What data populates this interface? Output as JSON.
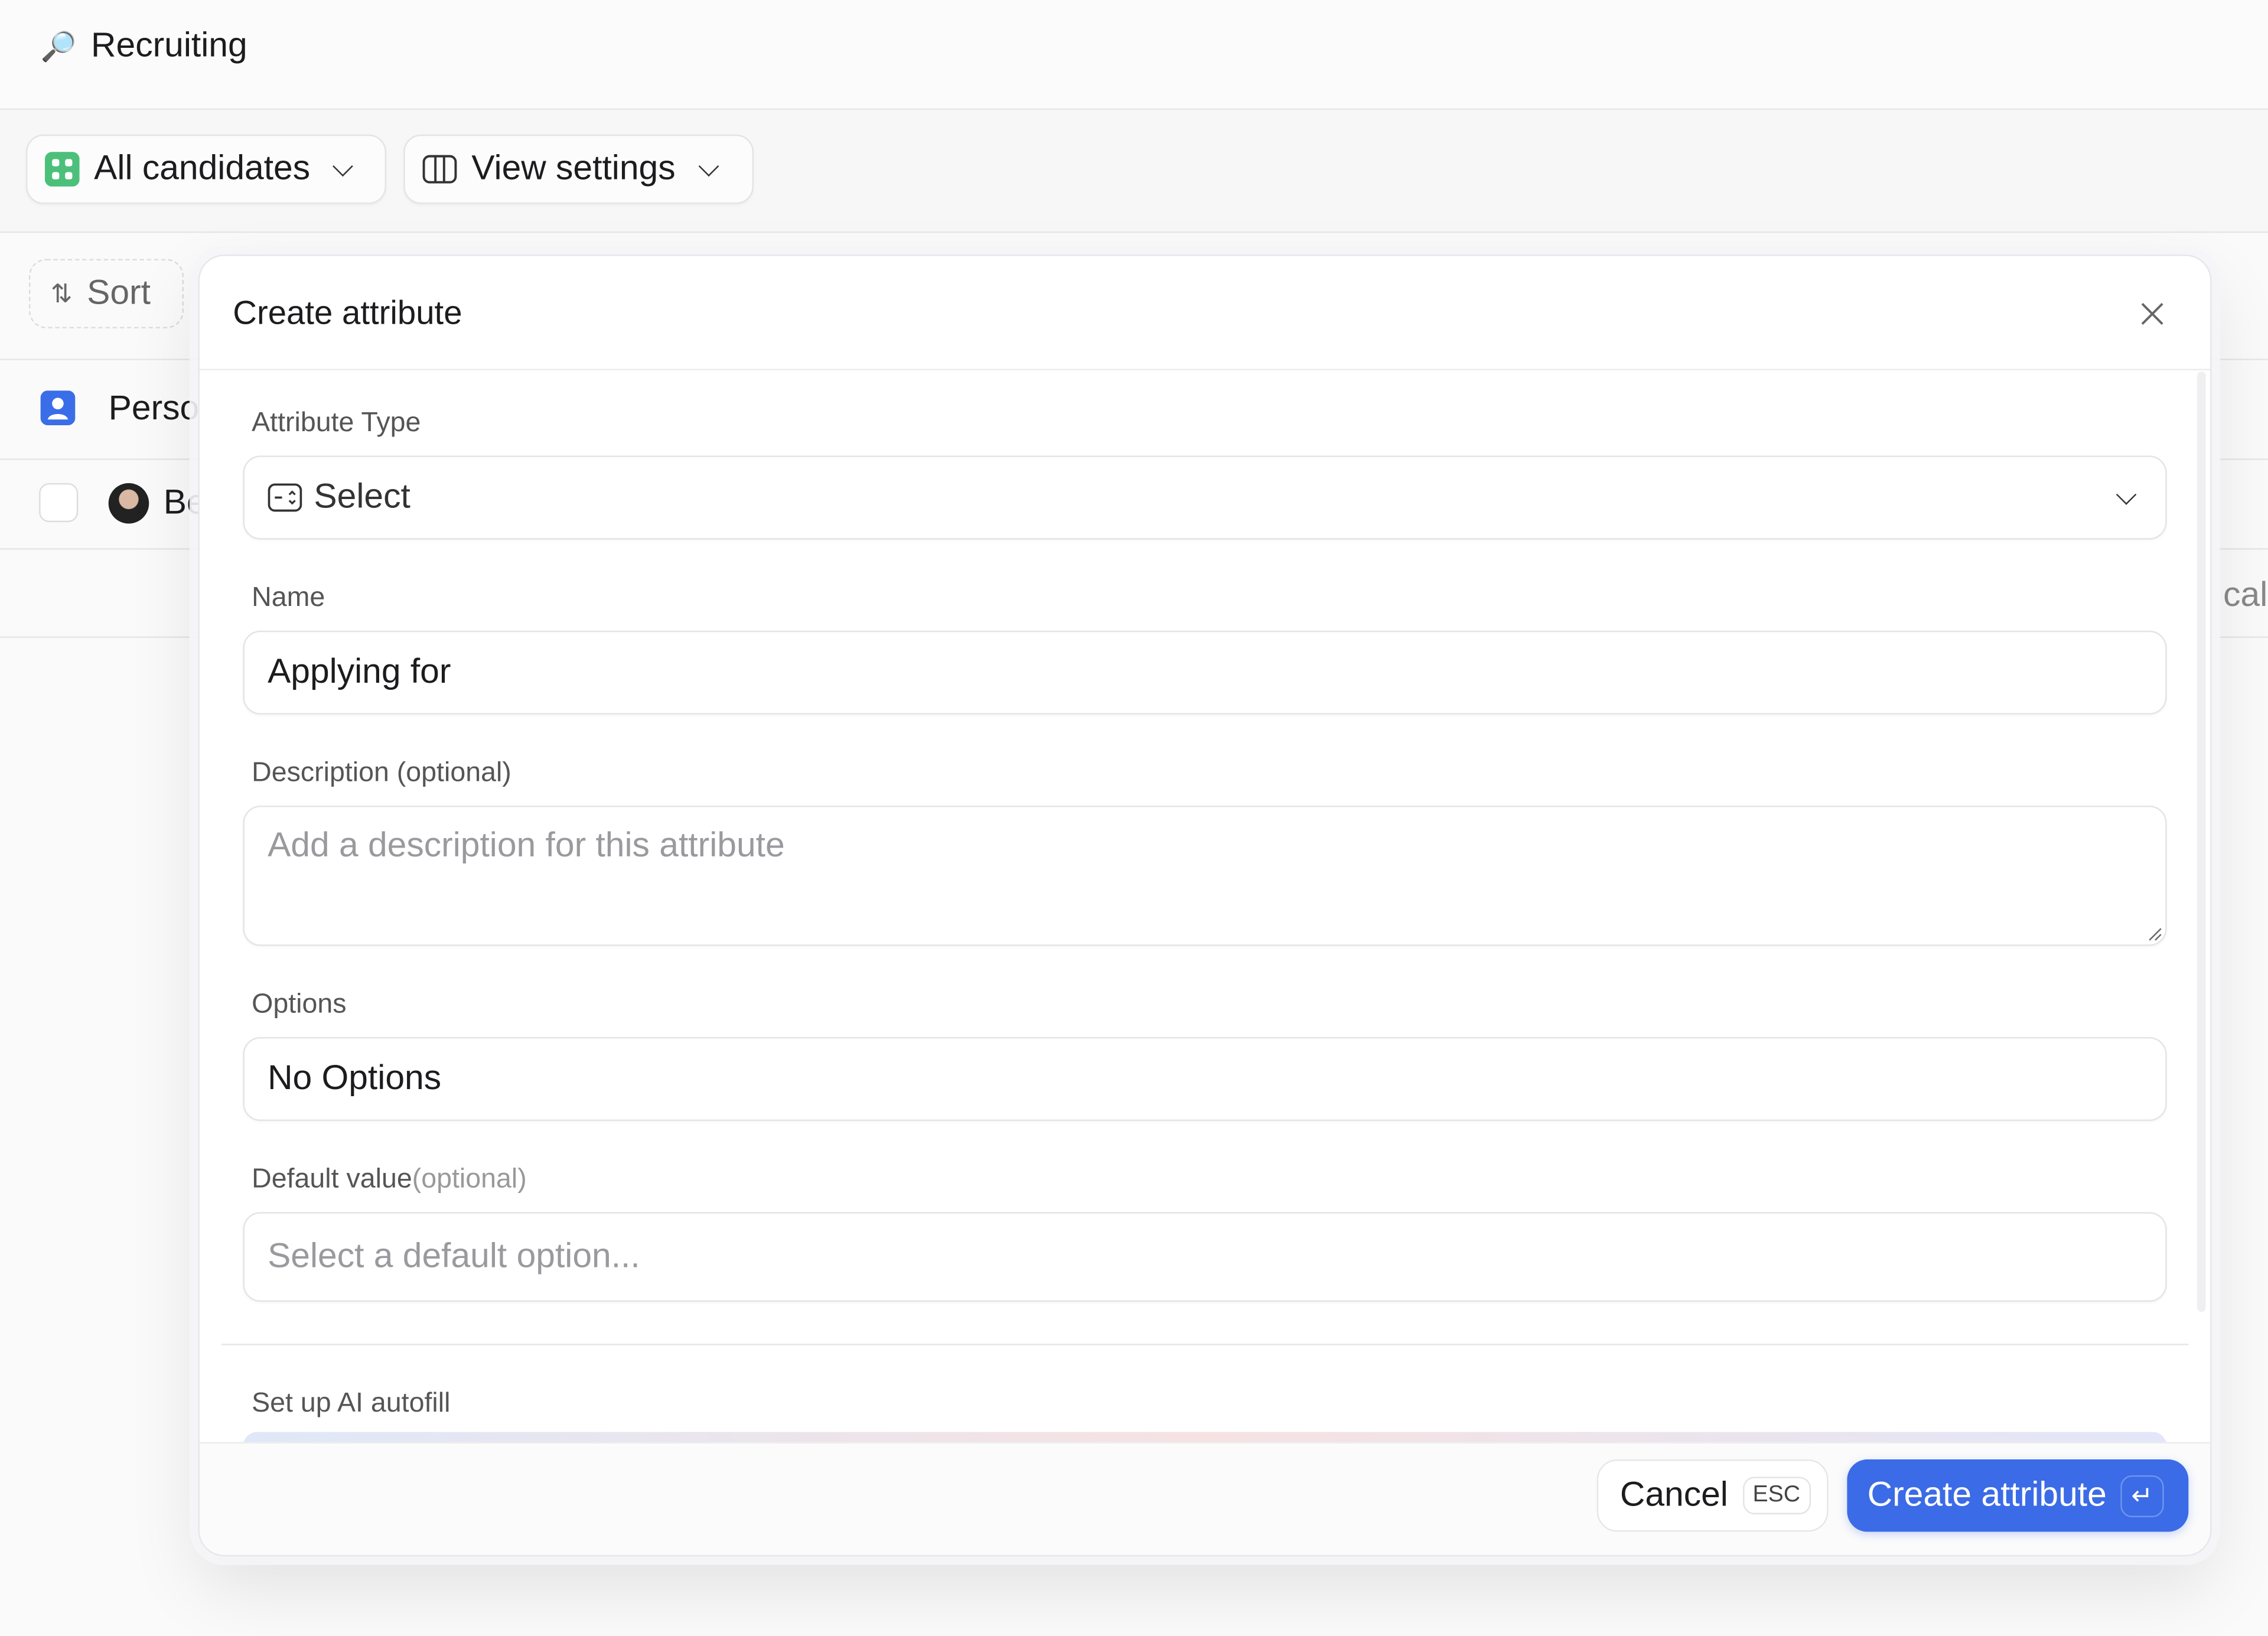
{
  "header": {
    "title": "Recruiting",
    "icon": "magnifier-icon"
  },
  "viewbar": {
    "view_label": "All candidates",
    "settings_label": "View settings"
  },
  "toolbar": {
    "sort_label": "Sort"
  },
  "table": {
    "group_label": "Perso",
    "row_name": "Be",
    "background_fragment": "cal"
  },
  "modal": {
    "title": "Create attribute",
    "attribute_type_label": "Attribute Type",
    "attribute_type_value": "Select",
    "name_label": "Name",
    "name_value": "Applying for",
    "description_label": "Description (optional)",
    "description_placeholder": "Add a description for this attribute",
    "options_label": "Options",
    "options_value": "No Options",
    "default_label": "Default value",
    "default_optional": "(optional)",
    "default_placeholder": "Select a default option...",
    "ai_label": "Set up AI autofill",
    "cancel_label": "Cancel",
    "cancel_kbd": "ESC",
    "create_label": "Create attribute",
    "create_kbd": "↵"
  },
  "colors": {
    "accent": "#3b6be6",
    "view_icon": "#4cc07a",
    "person_icon": "#3a6de8"
  }
}
